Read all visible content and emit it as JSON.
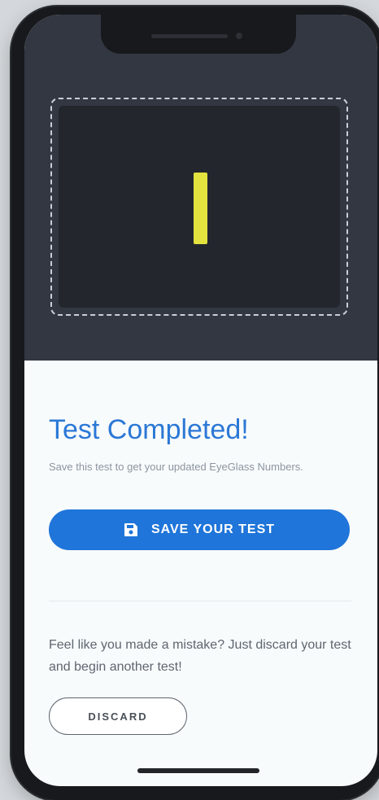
{
  "test_result": {
    "title": "Test Completed!",
    "subtitle": "Save this test to get your updated EyeGlass Numbers."
  },
  "actions": {
    "save_label": "SAVE YOUR TEST",
    "save_icon": "floppy-disk-icon",
    "mistake_text": "Feel like you made a mistake? Just discard your test and begin another test!",
    "discard_label": "DISCARD"
  },
  "colors": {
    "accent": "#1f75d9",
    "title": "#2b78d6",
    "test_mark": "#e3e23f",
    "scan_background": "#323742"
  }
}
